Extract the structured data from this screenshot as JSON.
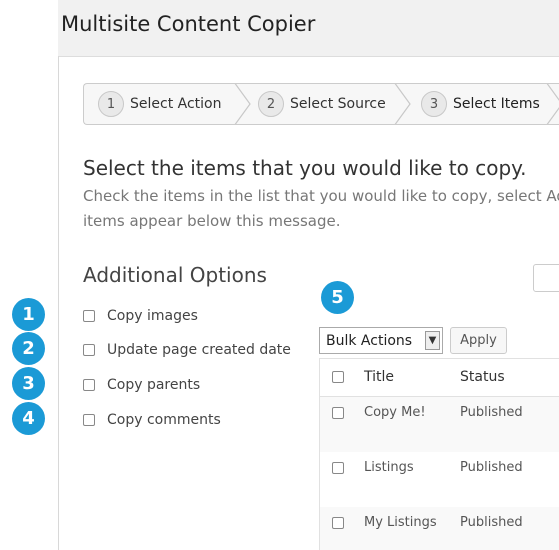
{
  "app": {
    "title": "Multisite Content Copier"
  },
  "wizard": {
    "steps": [
      {
        "number": "1",
        "label": "Select Action"
      },
      {
        "number": "2",
        "label": "Select Source"
      },
      {
        "number": "3",
        "label": "Select Items"
      }
    ]
  },
  "main": {
    "heading": "Select the items that you would like to copy.",
    "description_line1": "Check the items in the list that you would like to copy, select Ad",
    "description_line2": "items appear below this message."
  },
  "options": {
    "title": "Additional Options",
    "items": [
      {
        "badge": "1",
        "label": "Copy images"
      },
      {
        "badge": "2",
        "label": "Update page created date"
      },
      {
        "badge": "3",
        "label": "Copy parents"
      },
      {
        "badge": "4",
        "label": "Copy comments"
      }
    ]
  },
  "table_controls": {
    "badge": "5",
    "bulk_actions": "Bulk Actions",
    "apply": "Apply"
  },
  "table": {
    "columns": [
      "Title",
      "Status"
    ],
    "rows": [
      {
        "title": "Copy Me!",
        "status": "Published"
      },
      {
        "title": "Listings",
        "status": "Published"
      },
      {
        "title": "My Listings",
        "status": "Published"
      }
    ]
  },
  "colors": {
    "badge": "#1b9ad6",
    "header_bg": "#f1f1f1"
  }
}
